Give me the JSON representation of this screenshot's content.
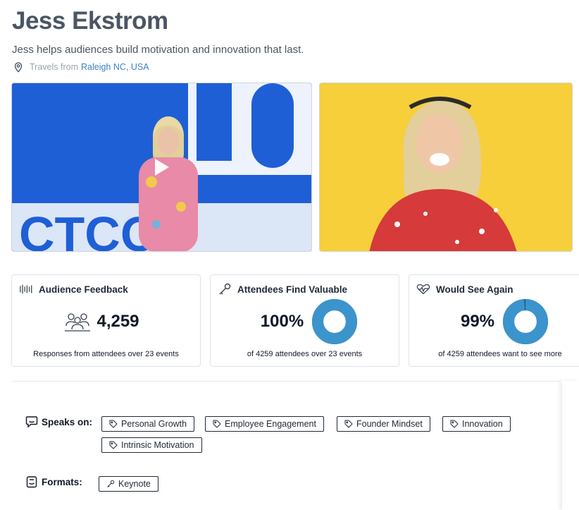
{
  "profile": {
    "name": "Jess Ekstrom",
    "tagline": "Jess helps audiences build motivation and innovation that last.",
    "travels_prefix": "Travels from",
    "location": "Raleigh NC, USA"
  },
  "media": {
    "video_icon": "play-icon",
    "photo_icon": "photo"
  },
  "stats": {
    "feedback": {
      "title": "Audience Feedback",
      "icon": "audio-wave-icon",
      "value": "4,259",
      "caption": "Responses from attendees over 23 events"
    },
    "valuable": {
      "title": "Attendees Find Valuable",
      "icon": "key-icon",
      "value": "100%",
      "fraction": 1.0,
      "caption": "of 4259 attendees over 23 events"
    },
    "see_again": {
      "title": "Would See Again",
      "icon": "heart-pulse-icon",
      "value": "99%",
      "fraction": 0.99,
      "caption": "of 4259 attendees want to see more"
    }
  },
  "speaks_on": {
    "label": "Speaks on:",
    "topics": [
      "Personal Growth",
      "Employee Engagement",
      "Founder Mindset",
      "Innovation",
      "Intrinsic Motivation"
    ]
  },
  "formats": {
    "label": "Formats:",
    "items": [
      "Keynote"
    ]
  },
  "colors": {
    "donut": "#3b94cc",
    "donut_rest": "#1f4e79",
    "link": "#3b82c4",
    "video_bg": "#1f5fd6",
    "photo_bg": "#f6cf3b"
  }
}
